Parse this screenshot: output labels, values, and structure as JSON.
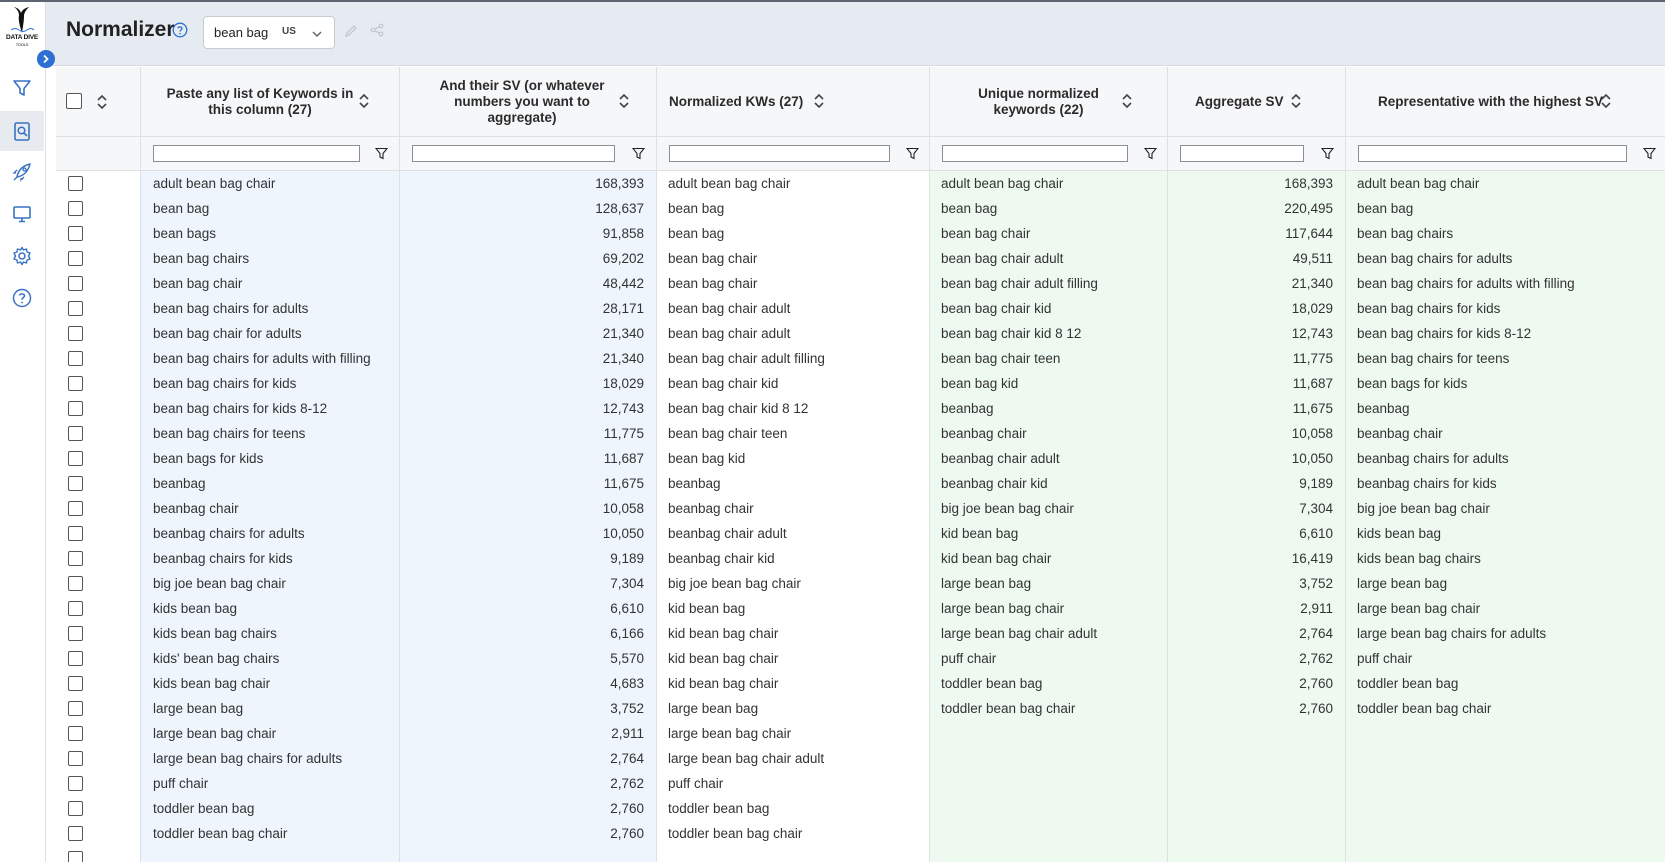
{
  "app": {
    "logo_text_line1": "DATA DIVE",
    "logo_text_line2": "TOOLS",
    "title": "Normalizer"
  },
  "search": {
    "value": "bean bag",
    "country": "US"
  },
  "sidebar": {
    "items": [
      {
        "name": "filter-icon"
      },
      {
        "name": "search-document-icon",
        "active": true
      },
      {
        "name": "rocket-icon"
      },
      {
        "name": "monitor-icon"
      },
      {
        "name": "gear-icon"
      },
      {
        "name": "help-icon"
      }
    ]
  },
  "columns": {
    "keywords": {
      "header": "Paste any list of Keywords in this column (27)"
    },
    "sv": {
      "header": "And their SV (or whatever numbers you want to aggregate)"
    },
    "normalized": {
      "header": "Normalized KWs (27)"
    },
    "unique": {
      "header": "Unique normalized keywords (22)"
    },
    "aggregate": {
      "header": "Aggregate SV"
    },
    "representative": {
      "header": "Representative with the highest SV"
    }
  },
  "keywords": [
    "adult bean bag chair",
    "bean bag",
    "bean bags",
    "bean bag chairs",
    "bean bag chair",
    "bean bag chairs for adults",
    "bean bag chair for adults",
    "bean bag chairs for adults with filling",
    "bean bag chairs for kids",
    "bean bag chairs for kids 8-12",
    "bean bag chairs for teens",
    "bean bags for kids",
    "beanbag",
    "beanbag chair",
    "beanbag chairs for adults",
    "beanbag chairs for kids",
    "big joe bean bag chair",
    "kids bean bag",
    "kids bean bag chairs",
    "kids' bean bag chairs",
    "kids bean bag chair",
    "large bean bag",
    "large bean bag chair",
    "large bean bag chairs for adults",
    "puff chair",
    "toddler bean bag",
    "toddler bean bag chair"
  ],
  "sv": [
    "168,393",
    "128,637",
    "91,858",
    "69,202",
    "48,442",
    "28,171",
    "21,340",
    "21,340",
    "18,029",
    "12,743",
    "11,775",
    "11,687",
    "11,675",
    "10,058",
    "10,050",
    "9,189",
    "7,304",
    "6,610",
    "6,166",
    "5,570",
    "4,683",
    "3,752",
    "2,911",
    "2,764",
    "2,762",
    "2,760",
    "2,760"
  ],
  "normalized": [
    "adult bean bag chair",
    "bean bag",
    "bean bag",
    "bean bag chair",
    "bean bag chair",
    "bean bag chair adult",
    "bean bag chair adult",
    "bean bag chair adult filling",
    "bean bag chair kid",
    "bean bag chair kid 8 12",
    "bean bag chair teen",
    "bean bag kid",
    "beanbag",
    "beanbag chair",
    "beanbag chair adult",
    "beanbag chair kid",
    "big joe bean bag chair",
    "kid bean bag",
    "kid bean bag chair",
    "kid bean bag chair",
    "kid bean bag chair",
    "large bean bag",
    "large bean bag chair",
    "large bean bag chair adult",
    "puff chair",
    "toddler bean bag",
    "toddler bean bag chair"
  ],
  "unique": [
    "adult bean bag chair",
    "bean bag",
    "bean bag chair",
    "bean bag chair adult",
    "bean bag chair adult filling",
    "bean bag chair kid",
    "bean bag chair kid 8 12",
    "bean bag chair teen",
    "bean bag kid",
    "beanbag",
    "beanbag chair",
    "beanbag chair adult",
    "beanbag chair kid",
    "big joe bean bag chair",
    "kid bean bag",
    "kid bean bag chair",
    "large bean bag",
    "large bean bag chair",
    "large bean bag chair adult",
    "puff chair",
    "toddler bean bag",
    "toddler bean bag chair"
  ],
  "aggregate": [
    "168,393",
    "220,495",
    "117,644",
    "49,511",
    "21,340",
    "18,029",
    "12,743",
    "11,775",
    "11,687",
    "11,675",
    "10,058",
    "10,050",
    "9,189",
    "7,304",
    "6,610",
    "16,419",
    "3,752",
    "2,911",
    "2,764",
    "2,762",
    "2,760",
    "2,760"
  ],
  "representative": [
    "adult bean bag chair",
    "bean bag",
    "bean bag chairs",
    "bean bag chairs for adults",
    "bean bag chairs for adults with filling",
    "bean bag chairs for kids",
    "bean bag chairs for kids 8-12",
    "bean bag chairs for teens",
    "bean bags for kids",
    "beanbag",
    "beanbag chair",
    "beanbag chairs for adults",
    "beanbag chairs for kids",
    "big joe bean bag chair",
    "kids bean bag",
    "kids bean bag chairs",
    "large bean bag",
    "large bean bag chair",
    "large bean bag chairs for adults",
    "puff chair",
    "toddler bean bag",
    "toddler bean bag chair"
  ],
  "colors": {
    "accent": "#2d6fd4",
    "sidebar_icon": "#3a72c4",
    "blue_column": "#eef5fc",
    "green_column": "#eefaf0"
  }
}
